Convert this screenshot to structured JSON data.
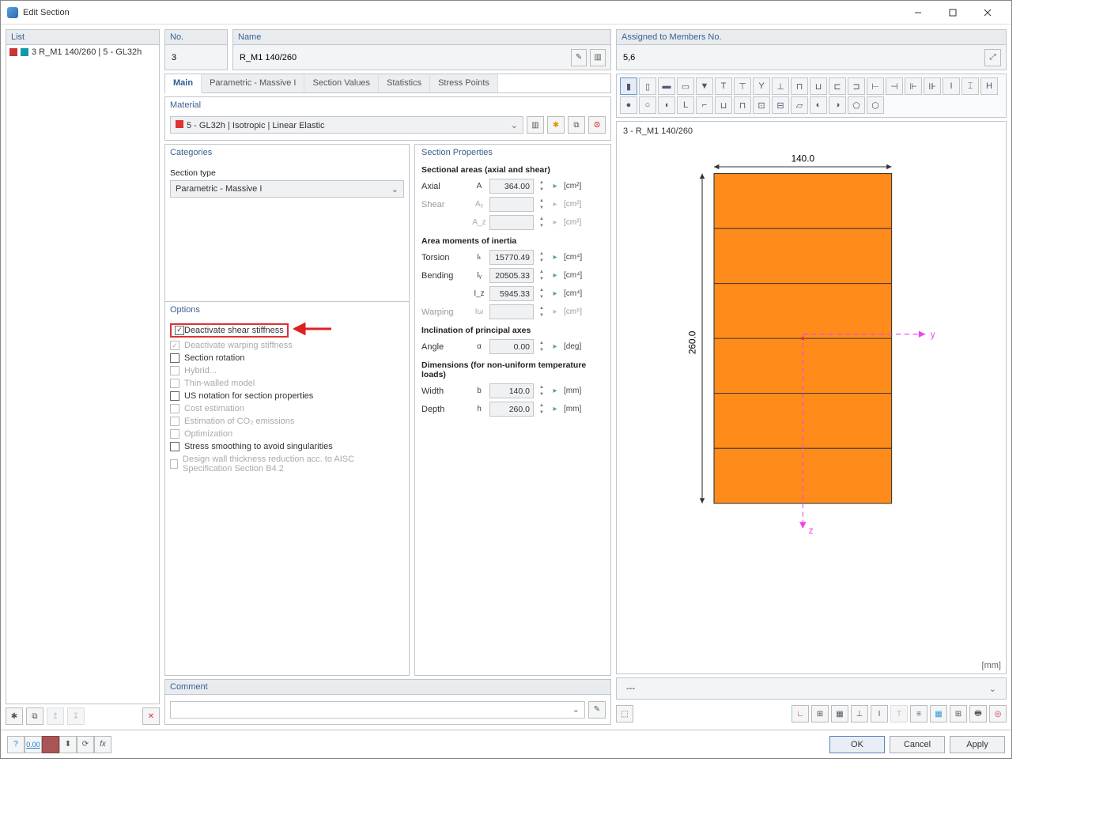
{
  "window": {
    "title": "Edit Section"
  },
  "list": {
    "header": "List",
    "item": "3  R_M1 140/260 | 5 - GL32h"
  },
  "fields": {
    "no_label": "No.",
    "no_value": "3",
    "name_label": "Name",
    "name_value": "R_M1 140/260",
    "assigned_label": "Assigned to Members No.",
    "assigned_value": "5,6"
  },
  "tabs": [
    "Main",
    "Parametric - Massive I",
    "Section Values",
    "Statistics",
    "Stress Points"
  ],
  "material": {
    "header": "Material",
    "value": "5 - GL32h | Isotropic | Linear Elastic"
  },
  "categories": {
    "header": "Categories",
    "section_type_lbl": "Section type",
    "section_type_val": "Parametric - Massive I"
  },
  "options": {
    "header": "Options",
    "items": [
      {
        "label": "Deactivate shear stiffness",
        "checked": true,
        "highlight": true
      },
      {
        "label": "Deactivate warping stiffness",
        "checked": true,
        "disabled": true
      },
      {
        "label": "Section rotation"
      },
      {
        "label": "Hybrid...",
        "disabled": true
      },
      {
        "label": "Thin-walled model",
        "disabled": true
      },
      {
        "label": "US notation for section properties"
      },
      {
        "label": "Cost estimation",
        "disabled": true
      },
      {
        "label": "Estimation of CO₂ emissions",
        "disabled": true
      },
      {
        "label": "Optimization",
        "disabled": true
      },
      {
        "label": "Stress smoothing to avoid singularities"
      },
      {
        "label": "Design wall thickness reduction acc. to AISC Specification Section B4.2",
        "disabled": true
      }
    ]
  },
  "props": {
    "header": "Section Properties",
    "areas_h": "Sectional areas (axial and shear)",
    "axial": {
      "n": "Axial",
      "s": "A",
      "v": "364.00",
      "u": "[cm²]"
    },
    "shear_y": {
      "n": "Shear",
      "s": "Aᵧ",
      "v": "",
      "u": "[cm²]",
      "dis": true
    },
    "shear_z": {
      "n": "",
      "s": "A_z",
      "v": "",
      "u": "[cm²]",
      "dis": true
    },
    "moments_h": "Area moments of inertia",
    "torsion": {
      "n": "Torsion",
      "s": "Iₜ",
      "v": "15770.49",
      "u": "[cm⁴]"
    },
    "bend_y": {
      "n": "Bending",
      "s": "Iᵧ",
      "v": "20505.33",
      "u": "[cm⁴]"
    },
    "bend_z": {
      "n": "",
      "s": "I_z",
      "v": "5945.33",
      "u": "[cm⁴]"
    },
    "warp": {
      "n": "Warping",
      "s": "Iω",
      "v": "",
      "u": "[cm⁶]",
      "dis": true
    },
    "incl_h": "Inclination of principal axes",
    "angle": {
      "n": "Angle",
      "s": "α",
      "v": "0.00",
      "u": "[deg]"
    },
    "dim_h": "Dimensions (for non-uniform temperature loads)",
    "width": {
      "n": "Width",
      "s": "b",
      "v": "140.0",
      "u": "[mm]"
    },
    "depth": {
      "n": "Depth",
      "s": "h",
      "v": "260.0",
      "u": "[mm]"
    }
  },
  "preview": {
    "title": "3 - R_M1 140/260",
    "width": "140.0",
    "height": "260.0",
    "unit": "[mm]",
    "selector_default": "---"
  },
  "comment": {
    "header": "Comment"
  },
  "buttons": {
    "ok": "OK",
    "cancel": "Cancel",
    "apply": "Apply"
  }
}
